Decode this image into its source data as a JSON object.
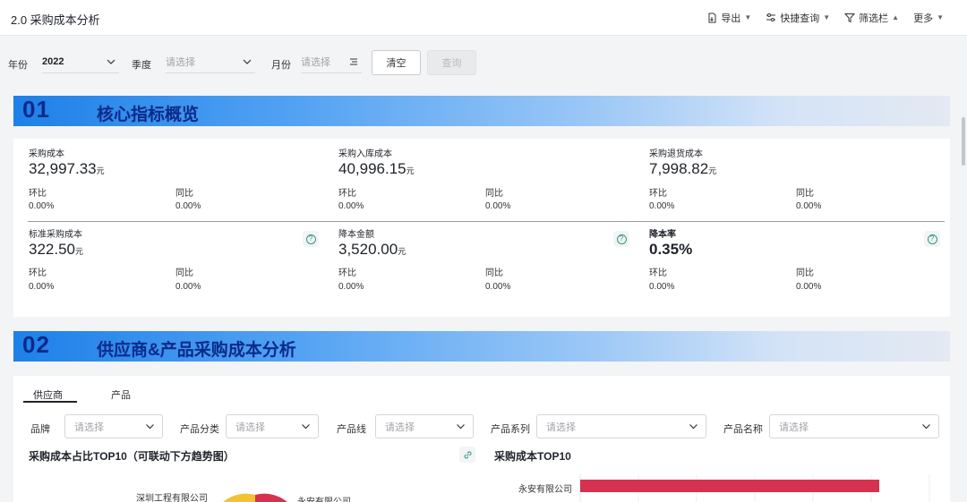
{
  "app": {
    "title": "2.0 采购成本分析"
  },
  "toolbar": {
    "export": "导出",
    "quick_query": "快捷查询",
    "filter_bar": "筛选栏",
    "more": "更多"
  },
  "filters": {
    "year_label": "年份",
    "year_value": "2022",
    "quarter_label": "季度",
    "quarter_placeholder": "请选择",
    "month_label": "月份",
    "month_placeholder": "请选择",
    "clear_label": "清空",
    "query_label": "查询"
  },
  "section1": {
    "num": "01",
    "title": "核心指标概览"
  },
  "kpis": [
    {
      "name": "采购成本",
      "value": "32,997.33",
      "unit": "元",
      "mom_label": "环比",
      "mom": "0.00%",
      "yoy_label": "同比",
      "yoy": "0.00%"
    },
    {
      "name": "采购入库成本",
      "value": "40,996.15",
      "unit": "元",
      "mom_label": "环比",
      "mom": "0.00%",
      "yoy_label": "同比",
      "yoy": "0.00%"
    },
    {
      "name": "采购退货成本",
      "value": "7,998.82",
      "unit": "元",
      "mom_label": "环比",
      "mom": "0.00%",
      "yoy_label": "同比",
      "yoy": "0.00%"
    },
    {
      "name": "标准采购成本",
      "value": "322.50",
      "unit": "元",
      "mom_label": "环比",
      "mom": "0.00%",
      "yoy_label": "同比",
      "yoy": "0.00%"
    },
    {
      "name": "降本金额",
      "value": "3,520.00",
      "unit": "元",
      "mom_label": "环比",
      "mom": "0.00%",
      "yoy_label": "同比",
      "yoy": "0.00%"
    },
    {
      "name": "降本率",
      "value": "0.35%",
      "unit": "",
      "mom_label": "环比",
      "mom": "0.00%",
      "yoy_label": "同比",
      "yoy": "0.00%"
    }
  ],
  "section2": {
    "num": "02",
    "title": "供应商&产品采购成本分析"
  },
  "tabs": {
    "supplier": "供应商",
    "product": "产品"
  },
  "analysis_filters": {
    "brand_label": "品牌",
    "category_label": "产品分类",
    "line_label": "产品线",
    "series_label": "产品系列",
    "name_label": "产品名称",
    "placeholder": "请选择"
  },
  "charts": {
    "pie_title": "采购成本占比TOP10（可联动下方趋势图）",
    "pie_labels": [
      "深圳工程有限公司",
      "永安有限公司"
    ],
    "bar_title": "采购成本TOP10",
    "bar_categories": [
      "永安有限公司"
    ]
  },
  "colors": {
    "accent": "#1e80e8",
    "section_text": "#0c2a8a",
    "bar": "#d6324f",
    "pie_yellow": "#f2c230",
    "pie_red": "#d6324f"
  }
}
